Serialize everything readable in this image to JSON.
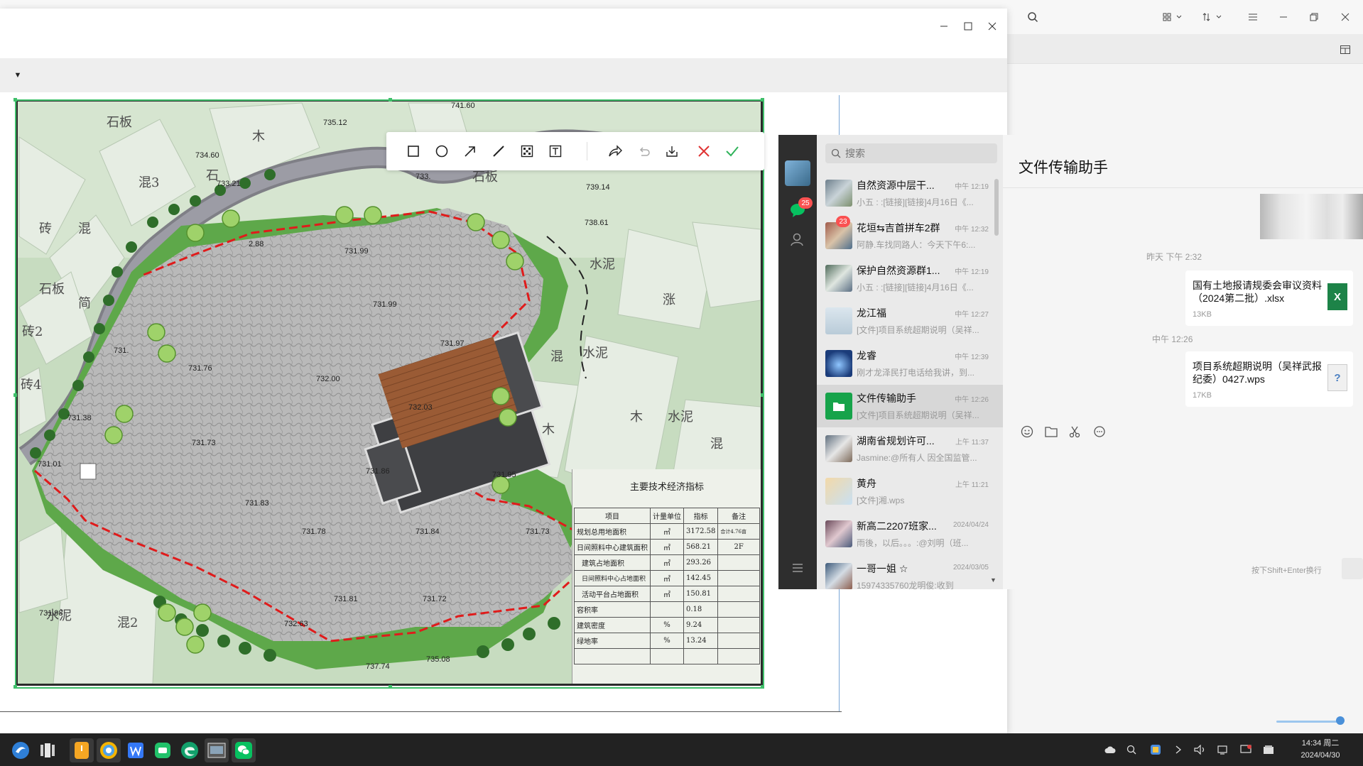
{
  "plan": {
    "table_title": "主要技术经济指标",
    "table_header": [
      "项目",
      "计量单位",
      "指标",
      "备注"
    ],
    "table_rows": [
      {
        "item": "规划总用地面积",
        "unit": "㎡",
        "value": "3172.58",
        "note": "合计4.76亩"
      },
      {
        "item": "日间照料中心建筑面积",
        "unit": "㎡",
        "value": "568.21",
        "note": "2F"
      },
      {
        "item": "建筑占地面积",
        "unit": "㎡",
        "value": "293.26",
        "note": ""
      },
      {
        "item": "日间照料中心占地面积",
        "unit": "㎡",
        "value": "142.45",
        "note": ""
      },
      {
        "item": "活动平台占地面积",
        "unit": "㎡",
        "value": "150.81",
        "note": ""
      },
      {
        "item": "容积率",
        "unit": "",
        "value": "0.18",
        "note": ""
      },
      {
        "item": "建筑密度",
        "unit": "%",
        "value": "9.24",
        "note": ""
      },
      {
        "item": "绿地率",
        "unit": "%",
        "value": "13.24",
        "note": ""
      },
      {
        "item": "",
        "unit": "",
        "value": "",
        "note": ""
      }
    ],
    "elevations": [
      "741.60",
      "735.12",
      "734.60",
      "733.21",
      "739.14",
      "738.61",
      "731.99",
      "731.99",
      "731.97",
      "731.76",
      "732.00",
      "732.03",
      "731.38",
      "731.73",
      "731.86",
      "731.95",
      "731.83",
      "731.78",
      "731.84",
      "731.73",
      "731.01",
      "731.81",
      "731.72",
      "732.63",
      "731.98",
      "737.74",
      "735.08",
      "733.",
      "731.",
      "2.88"
    ],
    "map_words": [
      "石板",
      "木",
      "混3",
      "砖",
      "混",
      "石板",
      "简",
      "砖2",
      "砖4",
      "水泥",
      "混2",
      "水泥",
      "水泥",
      "混",
      "木",
      "木",
      "水泥",
      "混",
      "涨",
      "石",
      "石板"
    ]
  },
  "wechat": {
    "search_placeholder": "搜索",
    "sidebar_badge": "25",
    "chats": [
      {
        "name": "自然资源中层干...",
        "time": "中午 12:19",
        "preview": "小五 : :[链接][链接]4月16日《...",
        "badge": ""
      },
      {
        "name": "花垣⇆吉首拼车2群",
        "time": "中午 12:32",
        "preview": "阿静.车找同路人：今天下午6:...",
        "badge": "23"
      },
      {
        "name": "保护自然资源群1...",
        "time": "中午 12:19",
        "preview": "小五 : :[链接][链接]4月16日《...",
        "badge": ""
      },
      {
        "name": "龙江福",
        "time": "中午 12:27",
        "preview": "[文件]项目系统超期说明（吴祥...",
        "badge": ""
      },
      {
        "name": "龙睿",
        "time": "中午 12:39",
        "preview": "刚才龙泽民打电话给我讲，到...",
        "badge": ""
      },
      {
        "name": "文件传输助手",
        "time": "中午 12:26",
        "preview": "[文件]项目系统超期说明（吴祥...",
        "badge": ""
      },
      {
        "name": "湖南省规划许可...",
        "time": "上午 11:37",
        "preview": "Jasmine:@所有人 因全国监管...",
        "badge": ""
      },
      {
        "name": "黄舟",
        "time": "上午 11:21",
        "preview": "[文件]湘.wps",
        "badge": ""
      },
      {
        "name": "新高二2207班家...",
        "time": "2024/04/24",
        "preview": "雨後，以后。。。:@刘明（班...",
        "badge": ""
      },
      {
        "name": "一哥一姐 ☆",
        "time": "2024/03/05",
        "preview": "15974335760龙明俊:收到",
        "badge": ""
      }
    ],
    "chat_title": "文件传输助手",
    "msg_time_1": "昨天 下午 2:32",
    "file_1": {
      "name": "国有土地报请规委会审议资料（2024第二批）.xlsx",
      "size": "13KB",
      "icon": "X"
    },
    "msg_time_2": "中午 12:26",
    "file_2": {
      "name": "项目系统超期说明（吴祥武报纪委）0427.wps",
      "size": "17KB",
      "icon": "?"
    },
    "send_hint": "按下Shift+Enter换行"
  },
  "taskbar": {
    "clock_time": "14:34 周二",
    "clock_date": "2024/04/30"
  }
}
